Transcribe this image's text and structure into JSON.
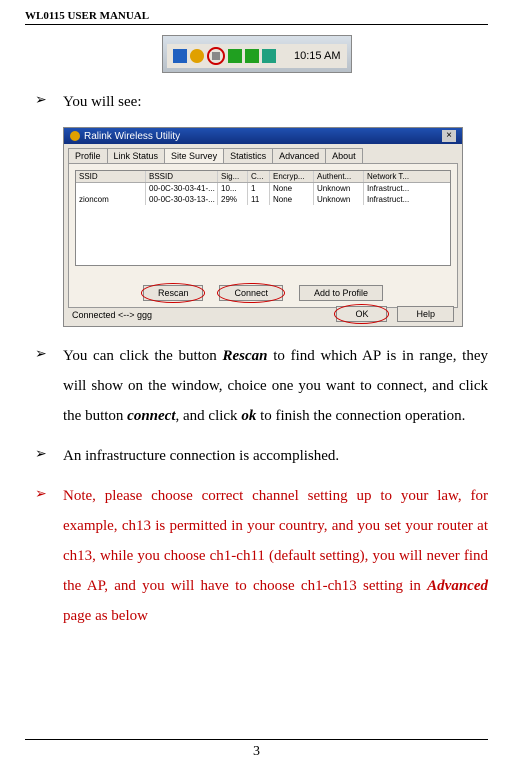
{
  "header": {
    "title": "WL0115 USER MANUAL"
  },
  "tray": {
    "time": "10:15 AM"
  },
  "bullets": {
    "b1": "You will see:",
    "b2_a": "You can click the button ",
    "b2_rescan": "Rescan",
    "b2_b": " to find which AP is in range, they will show on the window, choice one you want to connect, and click the button ",
    "b2_connect": "connect",
    "b2_c": ", and click ",
    "b2_ok": "ok",
    "b2_d": " to finish the connection operation.",
    "b3": "An infrastructure connection is accomplished.",
    "b4_a": "Note, please choose correct channel setting up to your law, for example, ch13 is permitted in your country, and you set your router at ch13, while you choose ch1-ch11 (default setting), you will never find the AP, and you will have to choose ch1-ch13 setting in ",
    "b4_adv": "Advanced",
    "b4_b": " page as below"
  },
  "dialog": {
    "title": "Ralink Wireless Utility",
    "tabs": [
      "Profile",
      "Link Status",
      "Site Survey",
      "Statistics",
      "Advanced",
      "About"
    ],
    "columns": [
      "SSID",
      "BSSID",
      "Sig...",
      "C...",
      "Encryp...",
      "Authent...",
      "Network T..."
    ],
    "rows": [
      {
        "ssid": "",
        "bssid": "00-0C-30-03-41-...",
        "sig": "10...",
        "ch": "1",
        "enc": "None",
        "auth": "Unknown",
        "net": "Infrastruct..."
      },
      {
        "ssid": "zioncom",
        "bssid": "00-0C-30-03-13-...",
        "sig": "29%",
        "ch": "11",
        "enc": "None",
        "auth": "Unknown",
        "net": "Infrastruct..."
      }
    ],
    "btn_rescan": "Rescan",
    "btn_connect": "Connect",
    "btn_addprofile": "Add to Profile",
    "btn_ok": "OK",
    "btn_help": "Help",
    "status": "Connected <--> ggg"
  },
  "pagenum": "3"
}
